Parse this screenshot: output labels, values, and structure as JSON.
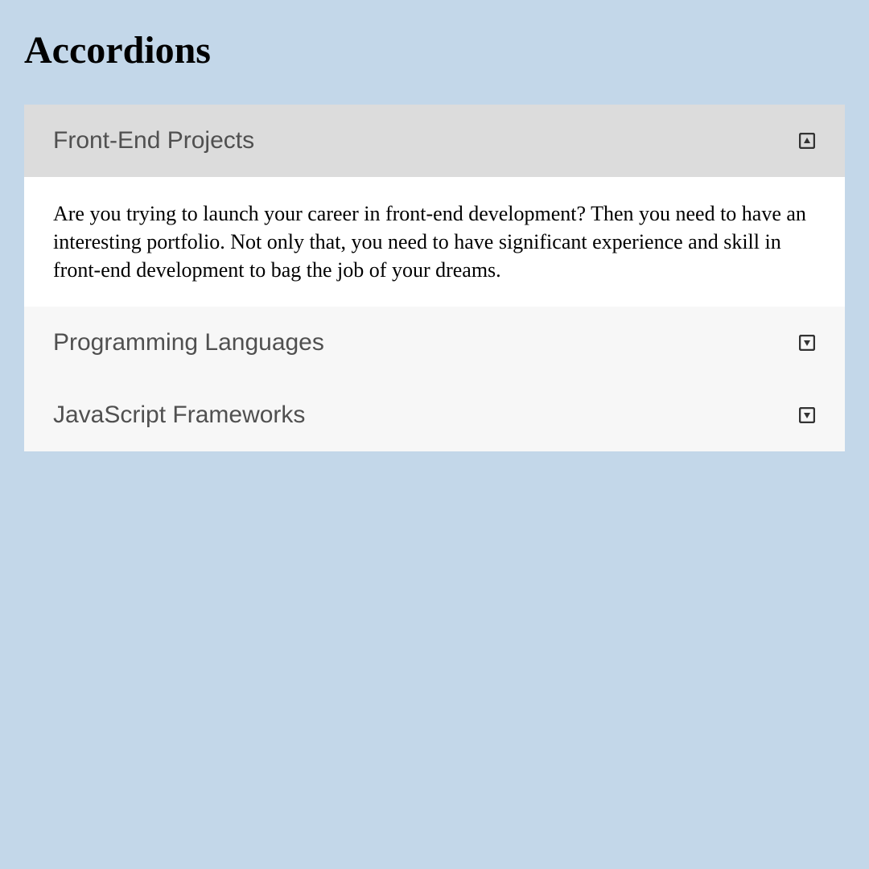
{
  "heading": "Accordions",
  "accordion": {
    "items": [
      {
        "title": "Front-End Projects",
        "expanded": true,
        "body": "Are you trying to launch your career in front-end development? Then you need to have an interesting portfolio. Not only that, you need to have significant experience and skill in front-end development to bag the job of your dreams."
      },
      {
        "title": "Programming Languages",
        "expanded": false
      },
      {
        "title": "JavaScript Frameworks",
        "expanded": false
      }
    ]
  },
  "colors": {
    "page_bg": "#c3d7e9",
    "header_active_bg": "#dcdcdc",
    "header_inactive_bg": "#f7f7f7",
    "body_bg": "#ffffff",
    "title_color": "#505050"
  }
}
